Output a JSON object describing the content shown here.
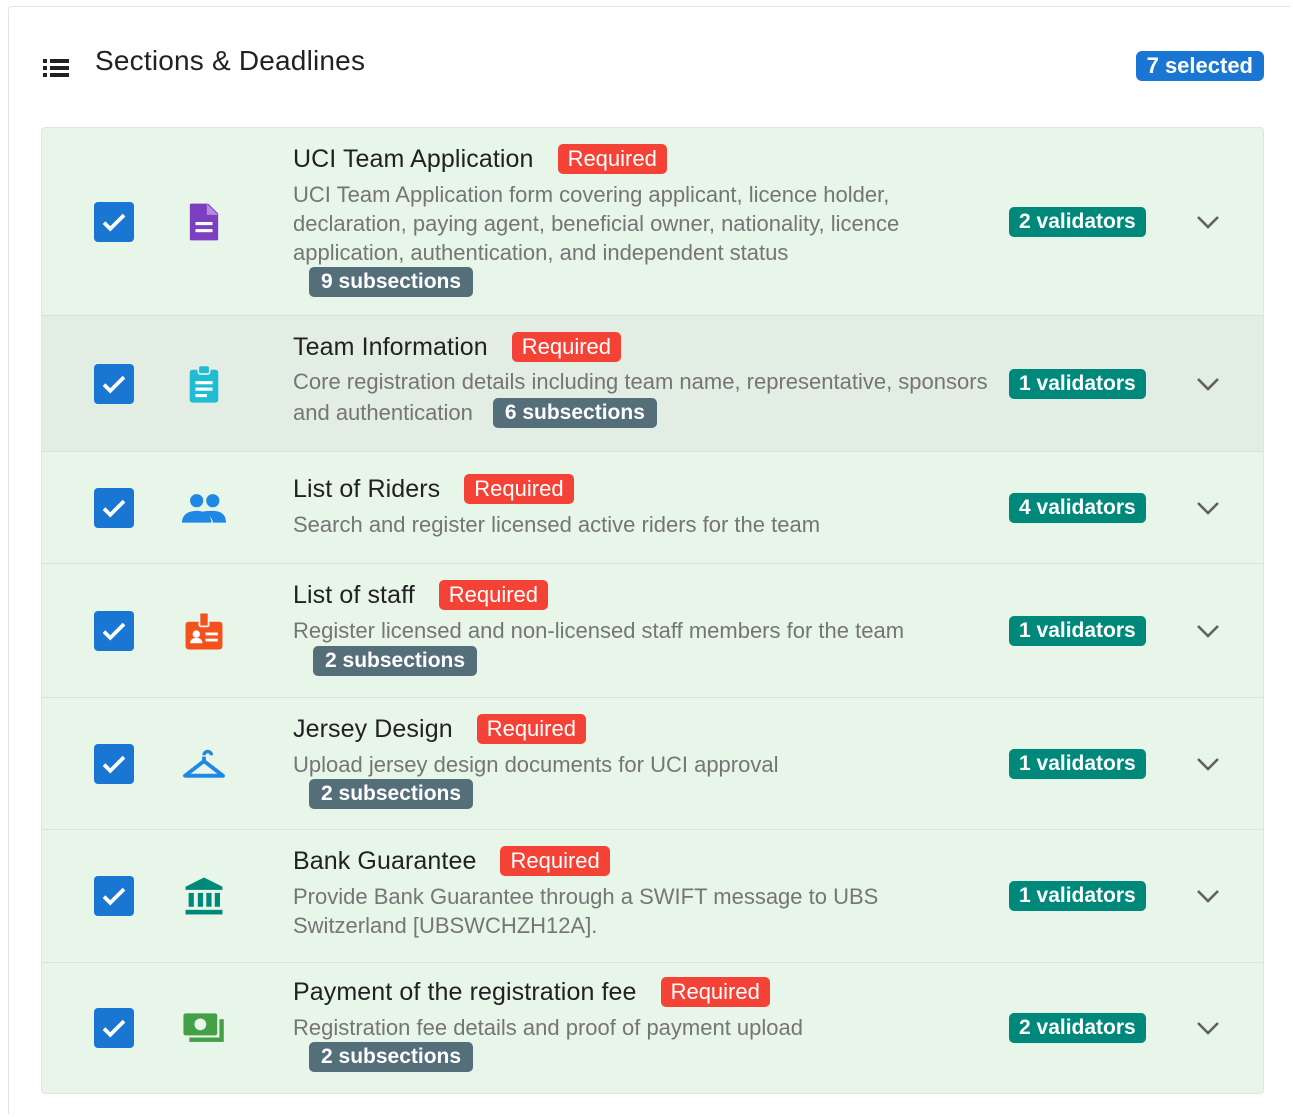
{
  "header": {
    "title": "Sections & Deadlines",
    "selected_label": "7 selected",
    "icon": "list-icon"
  },
  "colors": {
    "primary": "#1976d2",
    "required": "#f44336",
    "validator": "#00897b",
    "subsections": "#546e7a",
    "row_bg": "#e8f5e9"
  },
  "sections": [
    {
      "title": "UCI Team Application",
      "required_label": "Required",
      "description": "UCI Team Application form covering applicant, licence holder, declaration, paying agent, beneficial owner, nationality, licence application, authentication, and independent status",
      "subsections": "9 subsections",
      "validators": "2 validators",
      "icon": "document-icon",
      "icon_color": "#7b3fbf",
      "checked": true
    },
    {
      "title": "Team Information",
      "required_label": "Required",
      "description": "Core registration details including team name, representative, sponsors and authentication",
      "subsections": "6 subsections",
      "validators": "1 validators",
      "icon": "clipboard-icon",
      "icon_color": "#1fbcd3",
      "checked": true
    },
    {
      "title": "List of Riders",
      "required_label": "Required",
      "description": "Search and register licensed active riders for the team",
      "subsections": "",
      "validators": "4 validators",
      "icon": "people-icon",
      "icon_color": "#1e88e5",
      "checked": true
    },
    {
      "title": "List of staff",
      "required_label": "Required",
      "description": "Register licensed and non-licensed staff members for the team",
      "subsections": "2 subsections",
      "validators": "1 validators",
      "icon": "badge-icon",
      "icon_color": "#f4511e",
      "checked": true
    },
    {
      "title": "Jersey Design",
      "required_label": "Required",
      "description": "Upload jersey design documents for UCI approval",
      "subsections": "2 subsections",
      "validators": "1 validators",
      "icon": "hanger-icon",
      "icon_color": "#1e88e5",
      "checked": true
    },
    {
      "title": "Bank Guarantee",
      "required_label": "Required",
      "description": "Provide Bank Guarantee through a SWIFT message to UBS Switzerland [UBSWCHZH12A].",
      "subsections": "",
      "validators": "1 validators",
      "icon": "bank-icon",
      "icon_color": "#00897b",
      "checked": true
    },
    {
      "title": "Payment of the registration fee",
      "required_label": "Required",
      "description": "Registration fee details and proof of payment upload",
      "subsections": "2 subsections",
      "validators": "2 validators",
      "icon": "money-icon",
      "icon_color": "#43a047",
      "checked": true
    }
  ]
}
